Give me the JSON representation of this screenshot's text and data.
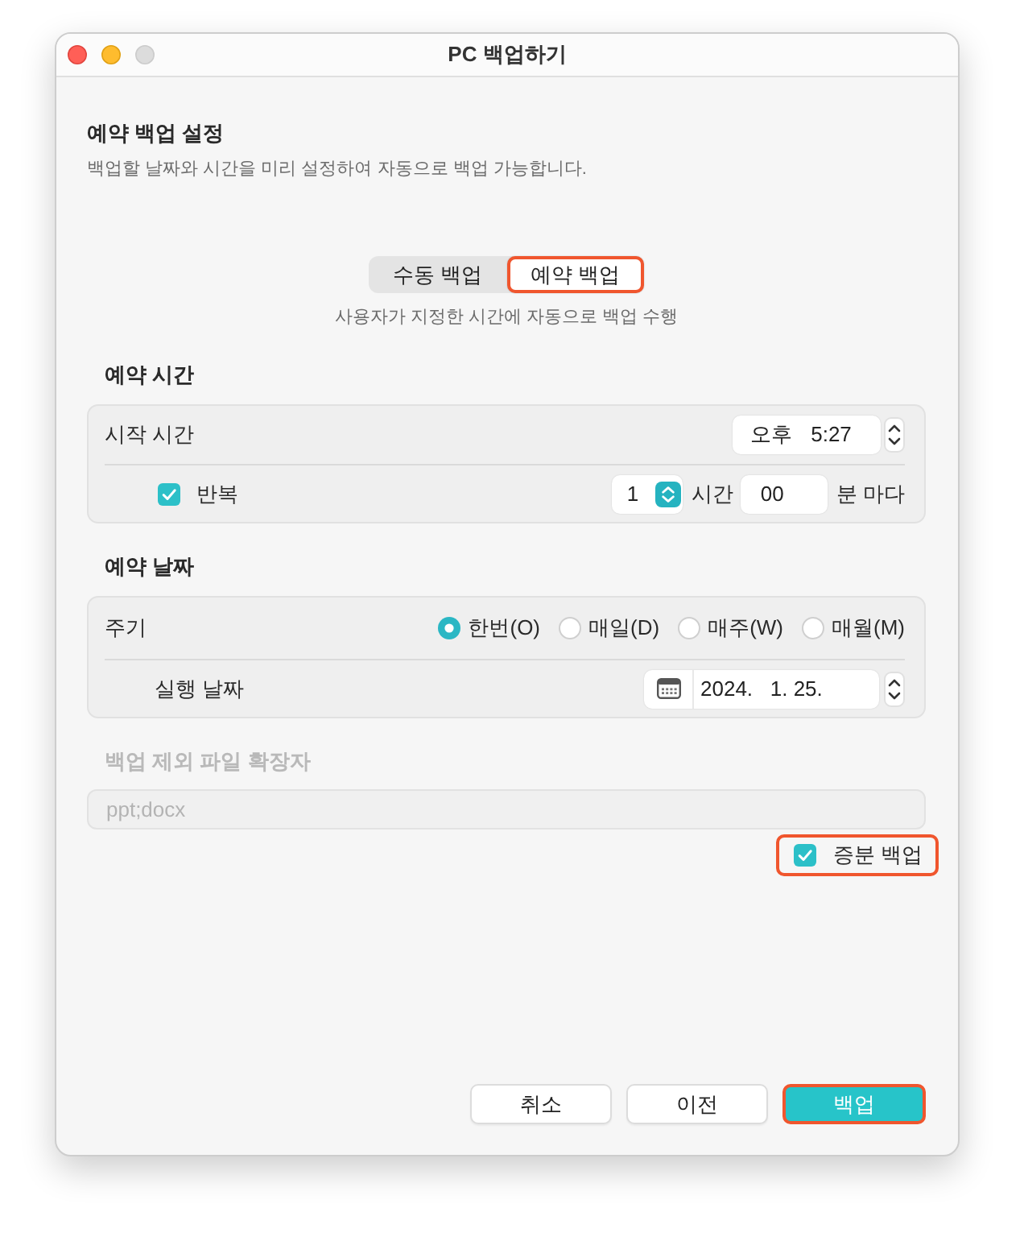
{
  "window": {
    "title": "PC 백업하기",
    "traffic_lights": [
      {
        "kind": "close",
        "disabled": false
      },
      {
        "kind": "minimize",
        "disabled": false
      },
      {
        "kind": "zoom",
        "disabled": true
      }
    ]
  },
  "header": {
    "title": "예약 백업 설정",
    "description": "백업할 날짜와 시간을 미리 설정하여 자동으로 백업 가능합니다."
  },
  "mode_switch": {
    "segments": [
      {
        "label": "수동 백업",
        "selected": false,
        "highlighted": false
      },
      {
        "label": "예약 백업",
        "selected": true,
        "highlighted": true
      }
    ],
    "caption": "사용자가 지정한 시간에 자동으로 백업 수행"
  },
  "schedule_time": {
    "title": "예약 시간",
    "start_label": "시작 시간",
    "start_time": "오후 5:27",
    "repeat": {
      "label": "반복",
      "checked": true,
      "hours": "1",
      "hours_unit": "시간",
      "minutes": "00",
      "minutes_unit": "분 마다"
    }
  },
  "schedule_date": {
    "title": "예약 날짜",
    "period_label": "주기",
    "periods": [
      {
        "label": "한번(O)",
        "selected": true
      },
      {
        "label": "매일(D)",
        "selected": false
      },
      {
        "label": "매주(W)",
        "selected": false
      },
      {
        "label": "매월(M)",
        "selected": false
      }
    ],
    "date_label": "실행 날짜",
    "date": "2024.   1. 25."
  },
  "exclusions": {
    "title": "백업 제외 파일 확장자",
    "value": "ppt;docx",
    "disabled": true
  },
  "incremental": {
    "label": "증분 백업",
    "checked": true,
    "highlighted": true
  },
  "buttons": [
    {
      "label": "취소",
      "kind": "secondary",
      "highlighted": false
    },
    {
      "label": "이전",
      "kind": "secondary",
      "highlighted": false
    },
    {
      "label": "백업",
      "kind": "primary",
      "highlighted": true
    }
  ]
}
